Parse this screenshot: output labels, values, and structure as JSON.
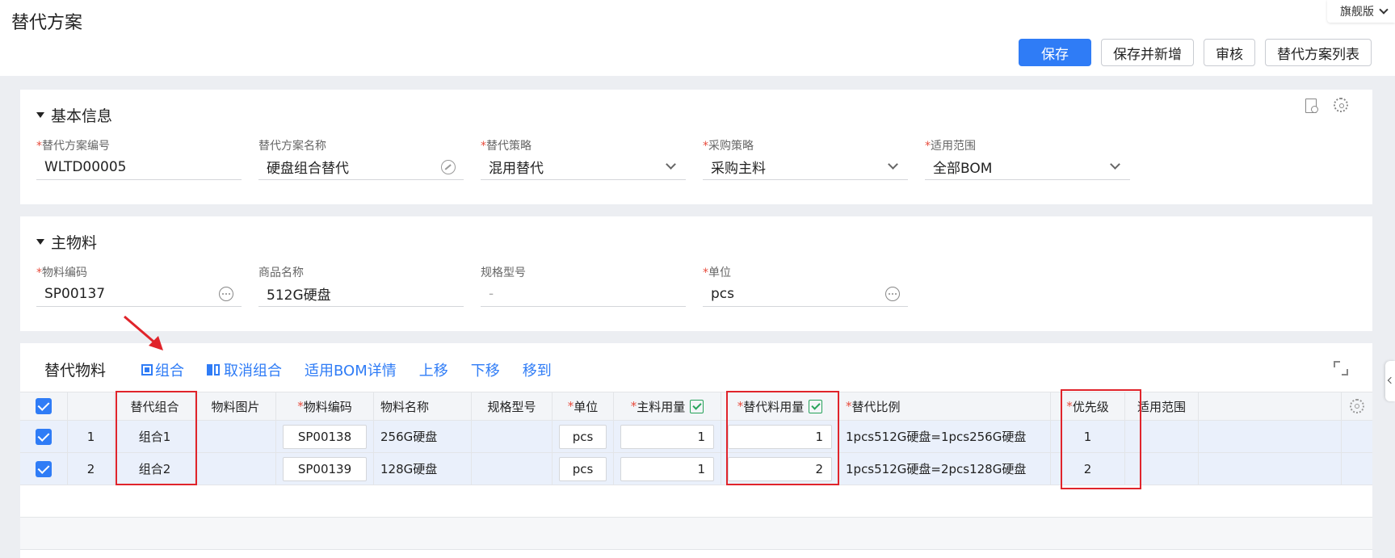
{
  "page": {
    "title": "替代方案",
    "edition": "旗舰版"
  },
  "toolbar": {
    "save": "保存",
    "save_new": "保存并新增",
    "audit": "审核",
    "list": "替代方案列表"
  },
  "basic": {
    "title": "基本信息",
    "fields": [
      {
        "label": "替代方案编号",
        "required": "*",
        "value": "WLTD00005"
      },
      {
        "label": "替代方案名称",
        "required": "",
        "value": "硬盘组合替代"
      },
      {
        "label": "替代策略",
        "required": "*",
        "value": "混用替代"
      },
      {
        "label": "采购策略",
        "required": "*",
        "value": "采购主料"
      },
      {
        "label": "适用范围",
        "required": "*",
        "value": "全部BOM"
      }
    ]
  },
  "main": {
    "title": "主物料",
    "fields": [
      {
        "label": "物料编码",
        "required": "*",
        "value": "SP00137"
      },
      {
        "label": "商品名称",
        "required": "",
        "value": "512G硬盘"
      },
      {
        "label": "规格型号",
        "required": "",
        "value": "-"
      },
      {
        "label": "单位",
        "required": "*",
        "value": "pcs"
      }
    ]
  },
  "sub": {
    "title": "替代物料",
    "actions": {
      "group": "组合",
      "ungroup": "取消组合",
      "bom_detail": "适用BOM详情",
      "up": "上移",
      "down": "下移",
      "move_to": "移到"
    },
    "columns": {
      "group": "替代组合",
      "image": "物料图片",
      "code": "物料编码",
      "name": "物料名称",
      "spec": "规格型号",
      "unit": "单位",
      "main_qty": "主料用量",
      "sub_qty": "替代料用量",
      "ratio": "替代比例",
      "priority": "优先级",
      "scope": "适用范围",
      "req": "*"
    },
    "rows": [
      {
        "seq": "1",
        "group": "组合1",
        "code": "SP00138",
        "name": "256G硬盘",
        "unit": "pcs",
        "main_qty": "1",
        "sub_qty": "1",
        "ratio": "1pcs512G硬盘=1pcs256G硬盘",
        "priority": "1"
      },
      {
        "seq": "2",
        "group": "组合2",
        "code": "SP00139",
        "name": "128G硬盘",
        "unit": "pcs",
        "main_qty": "1",
        "sub_qty": "2",
        "ratio": "1pcs512G硬盘=2pcs128G硬盘",
        "priority": "2"
      }
    ]
  },
  "colors": {
    "accent": "#2f7cf6",
    "highlight": "#e0242b",
    "required": "#e84c3d"
  },
  "icons": [
    "chevron-down-icon",
    "doc-settings-icon",
    "gear-icon",
    "more-icon",
    "refresh-icon",
    "group-icon",
    "ungroup-icon",
    "expand-icon",
    "checkbox-icon",
    "edit-column-icon",
    "arrow-annotation"
  ]
}
